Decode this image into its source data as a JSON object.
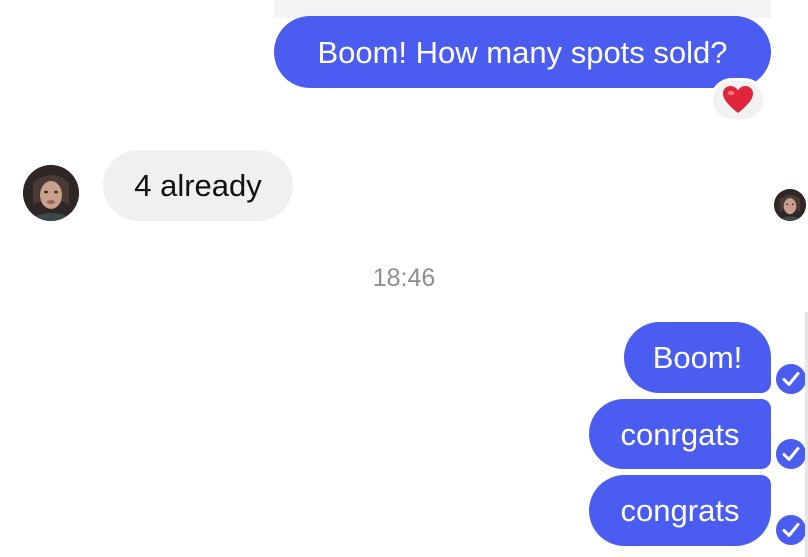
{
  "messages": [
    {
      "id": "m1",
      "direction": "outgoing",
      "text": "Boom! How many spots sold?",
      "reaction": "heart"
    },
    {
      "id": "m2",
      "direction": "incoming",
      "text": "4 already"
    },
    {
      "id": "m3",
      "direction": "outgoing",
      "text": "Boom!",
      "status": "delivered"
    },
    {
      "id": "m4",
      "direction": "outgoing",
      "text": "conrgats",
      "status": "delivered"
    },
    {
      "id": "m5",
      "direction": "outgoing",
      "text": "congrats",
      "status": "delivered"
    }
  ],
  "timestamp": "18:46",
  "icons": {
    "reaction": "heart-icon",
    "status": "check-circle-icon",
    "avatar": "contact-avatar"
  },
  "colors": {
    "outgoing_bubble": "#4b5cf0",
    "incoming_bubble": "#f0f0f0",
    "timestamp_text": "#8e8e93",
    "heart": "#e0243a"
  }
}
